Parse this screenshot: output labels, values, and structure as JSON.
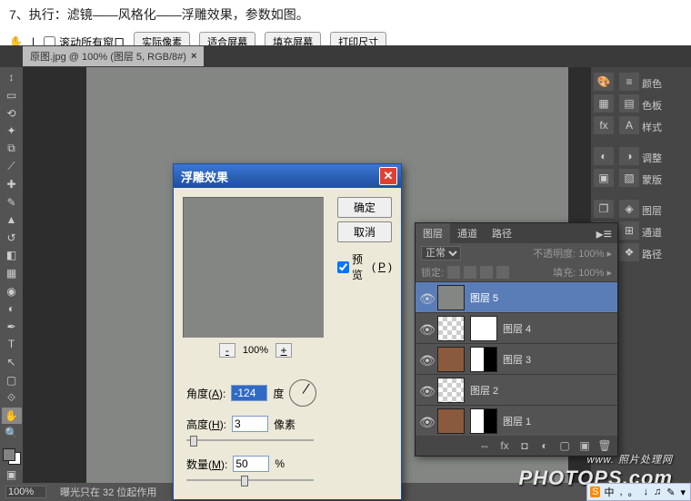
{
  "instruction": "7、执行：滤镜——风格化——浮雕效果，参数如图。",
  "top_toolbar": {
    "scroll_all": "滚动所有窗口",
    "actual_pixels": "实际像素",
    "fit_screen": "适合屏幕",
    "fill_screen": "填充屏幕",
    "print_size": "打印尺寸"
  },
  "doc_tab": {
    "title": "原图.jpg @ 100% (图层 5, RGB/8#)"
  },
  "dialog": {
    "title": "浮雕效果",
    "ok": "确定",
    "cancel": "取消",
    "preview": "预览",
    "preview_key": "P",
    "zoom": "100%",
    "angle_label": "角度",
    "angle_key": "A",
    "angle_value": "-124",
    "angle_unit": "度",
    "height_label": "高度",
    "height_key": "H",
    "height_value": "3",
    "height_unit": "像素",
    "amount_label": "数量",
    "amount_key": "M",
    "amount_value": "50",
    "amount_unit": "%"
  },
  "layers_panel": {
    "tabs": {
      "layers": "图层",
      "channels": "通道",
      "paths": "路径"
    },
    "blend_mode": "正常",
    "opacity_label": "不透明度:",
    "opacity_value": "100%",
    "lock_label": "锁定:",
    "fill_label": "填充:",
    "fill_value": "100%",
    "items": [
      {
        "name": "图层 5"
      },
      {
        "name": "图层 4"
      },
      {
        "name": "图层 3"
      },
      {
        "name": "图层 2"
      },
      {
        "name": "图层 1"
      }
    ]
  },
  "right_dock": {
    "color": "颜色",
    "swatches": "色板",
    "styles": "样式",
    "adjust": "调整",
    "mask": "蒙版",
    "layers": "图层",
    "channels": "通道",
    "paths": "路径"
  },
  "status": {
    "zoom": "100%",
    "msg": "曝光只在 32 位起作用"
  },
  "watermark": {
    "line1": "www.",
    "line2": "照片处理网",
    "line3": "PHOTOPS.com"
  },
  "ime": {
    "items": [
      "S",
      "中",
      ",",
      "。",
      "↓",
      "♫",
      "✎",
      "▾"
    ]
  }
}
